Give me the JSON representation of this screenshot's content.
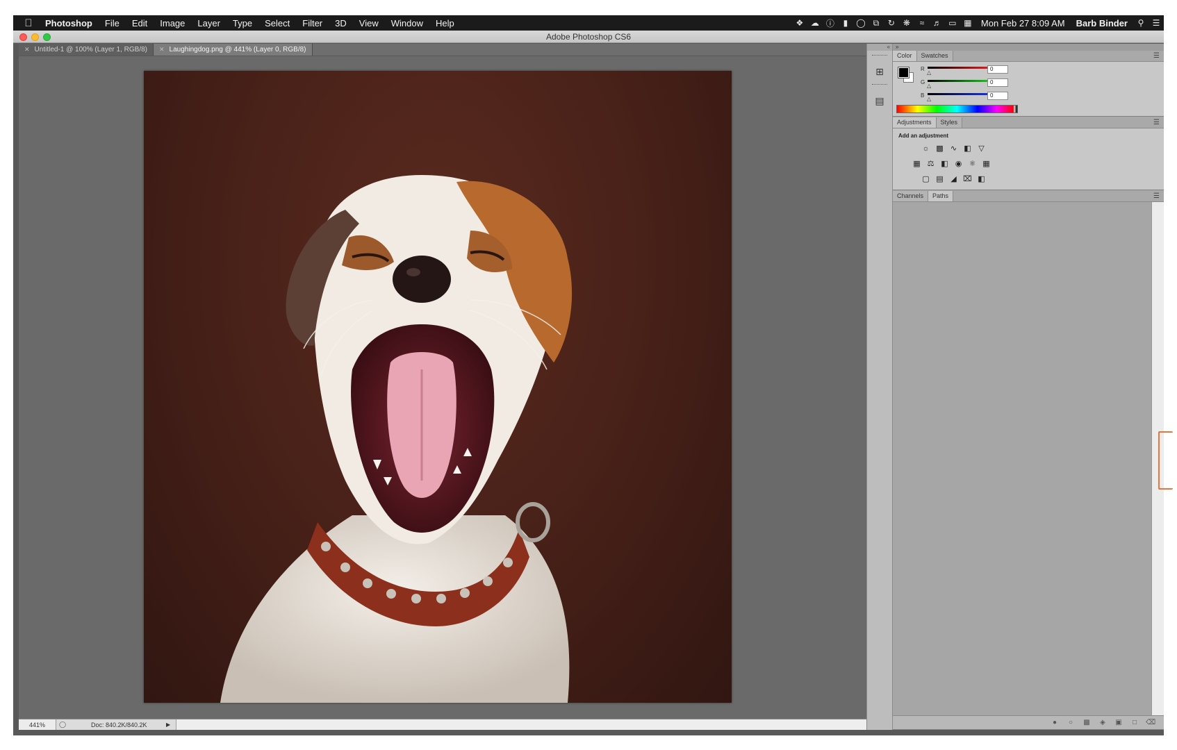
{
  "menubar": {
    "app_name": "Photoshop",
    "menus": [
      "File",
      "Edit",
      "Image",
      "Layer",
      "Type",
      "Select",
      "Filter",
      "3D",
      "View",
      "Window",
      "Help"
    ],
    "clock": "Mon Feb 27  8:09 AM",
    "user": "Barb Binder"
  },
  "window": {
    "title": "Adobe Photoshop CS6"
  },
  "doc_tabs": [
    {
      "label": "Untitled-1 @ 100% (Layer 1, RGB/8)"
    },
    {
      "label": "Laughingdog.png @ 441% (Layer 0, RGB/8)"
    }
  ],
  "status": {
    "zoom": "441%",
    "doc_size": "Doc: 840.2K/840.2K"
  },
  "color_panel": {
    "tabs": [
      "Color",
      "Swatches"
    ],
    "channels": [
      {
        "label": "R",
        "value": "0",
        "color": "#d01010"
      },
      {
        "label": "G",
        "value": "0",
        "color": "#10b010"
      },
      {
        "label": "B",
        "value": "0",
        "color": "#1020d0"
      }
    ]
  },
  "adjustments_panel": {
    "tabs": [
      "Adjustments",
      "Styles"
    ],
    "heading": "Add an adjustment"
  },
  "paths_panel": {
    "tabs": [
      "Channels",
      "Paths"
    ]
  }
}
